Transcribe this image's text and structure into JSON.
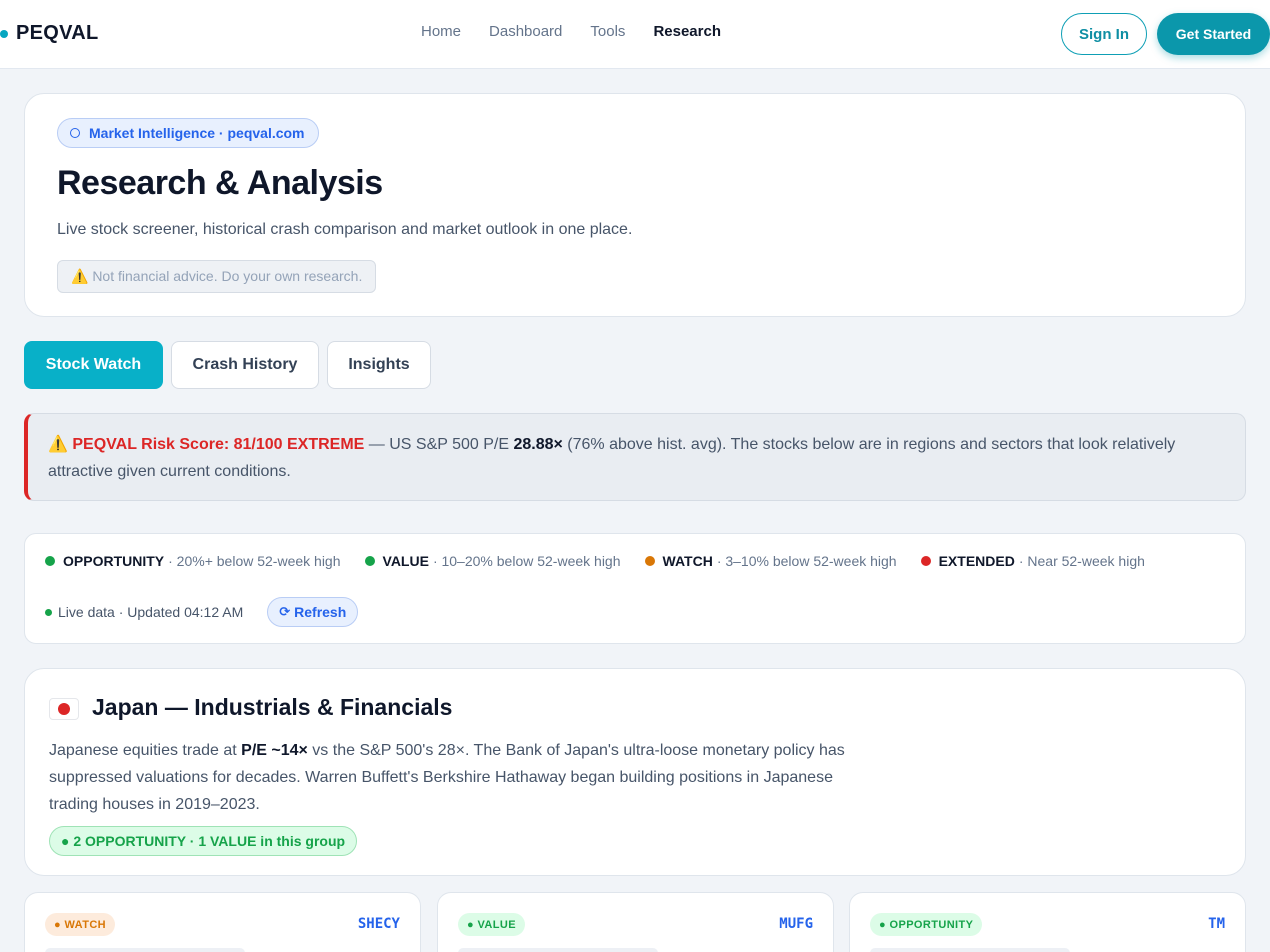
{
  "header": {
    "brand": "PEQVAL",
    "nav": [
      "Home",
      "Dashboard",
      "Tools",
      "Research"
    ],
    "active_nav": "Research",
    "sign_in": "Sign In",
    "get_started": "Get Started"
  },
  "hero": {
    "pill": "Market Intelligence · peqval.com",
    "title": "Research & Analysis",
    "subtitle": "Live stock screener, historical crash comparison and market outlook in one place.",
    "disclaimer": "⚠️ Not financial advice. Do your own research."
  },
  "tabs": [
    "Stock Watch",
    "Crash History",
    "Insights"
  ],
  "alert": {
    "icon": "⚠️",
    "risk": "PEQVAL Risk Score: 81/100 EXTREME",
    "pre_pe": " — US S&P 500 P/E ",
    "pe": "28.88×",
    "rest": " (76% above hist. avg). The stocks below are in regions and sectors that look relatively attractive given current conditions."
  },
  "legend": {
    "items": [
      {
        "name": "OPPORTUNITY",
        "desc": "· 20%+ below 52-week high",
        "color": "#16a34a"
      },
      {
        "name": "VALUE",
        "desc": "· 10–20% below 52-week high",
        "color": "#16a34a"
      },
      {
        "name": "WATCH",
        "desc": "· 3–10% below 52-week high",
        "color": "#d97706"
      },
      {
        "name": "EXTENDED",
        "desc": "· Near 52-week high",
        "color": "#dc2626"
      }
    ],
    "status": "Live data · Updated 04:12 AM",
    "refresh": "Refresh"
  },
  "group": {
    "title": "Japan — Industrials & Financials",
    "desc_pre": "Japanese equities trade at ",
    "desc_bold": "P/E ~14×",
    "desc_post": " vs the S&P 500's 28×. The Bank of Japan's ultra-loose monetary policy has suppressed valuations for decades. Warren Buffett's Berkshire Hathaway began building positions in Japanese trading houses in 2019–2023.",
    "badge": "● 2 OPPORTUNITY · 1 VALUE in this group"
  },
  "stocks": [
    {
      "tag": "● WATCH",
      "ticker": "SHECY"
    },
    {
      "tag": "● VALUE",
      "ticker": "MUFG"
    },
    {
      "tag": "● OPPORTUNITY",
      "ticker": "TM"
    }
  ]
}
